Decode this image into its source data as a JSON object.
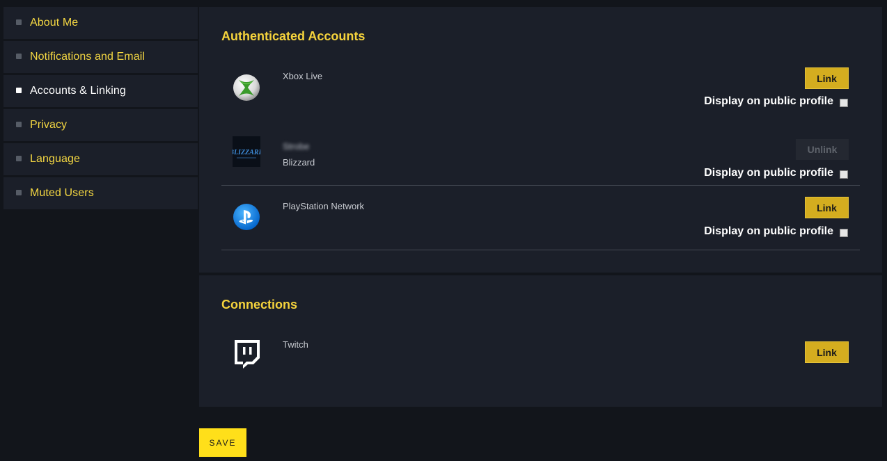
{
  "sidebar": {
    "items": [
      {
        "label": "About Me",
        "active": false
      },
      {
        "label": "Notifications and Email",
        "active": false
      },
      {
        "label": "Accounts & Linking",
        "active": true
      },
      {
        "label": "Privacy",
        "active": false
      },
      {
        "label": "Language",
        "active": false
      },
      {
        "label": "Muted Users",
        "active": false
      }
    ]
  },
  "authenticated": {
    "title": "Authenticated Accounts",
    "accounts": [
      {
        "name": "Xbox Live",
        "button": "Link",
        "display_label": "Display on public profile",
        "logo": "xbox-logo-icon"
      },
      {
        "username": "Strobe",
        "name": "Blizzard",
        "button": "Unlink",
        "display_label": "Display on public profile",
        "logo": "blizzard-logo-icon"
      },
      {
        "name": "PlayStation Network",
        "button": "Link",
        "display_label": "Display on public profile",
        "logo": "playstation-logo-icon"
      }
    ]
  },
  "connections": {
    "title": "Connections",
    "accounts": [
      {
        "name": "Twitch",
        "button": "Link",
        "logo": "twitch-logo-icon"
      }
    ]
  },
  "save_label": "SAVE",
  "colors": {
    "accent_yellow": "#f5d33c",
    "button_gold": "#d4ad1f",
    "save_yellow": "#ffdf1a",
    "panel_bg": "#1b1f29",
    "page_bg": "#12151b"
  }
}
